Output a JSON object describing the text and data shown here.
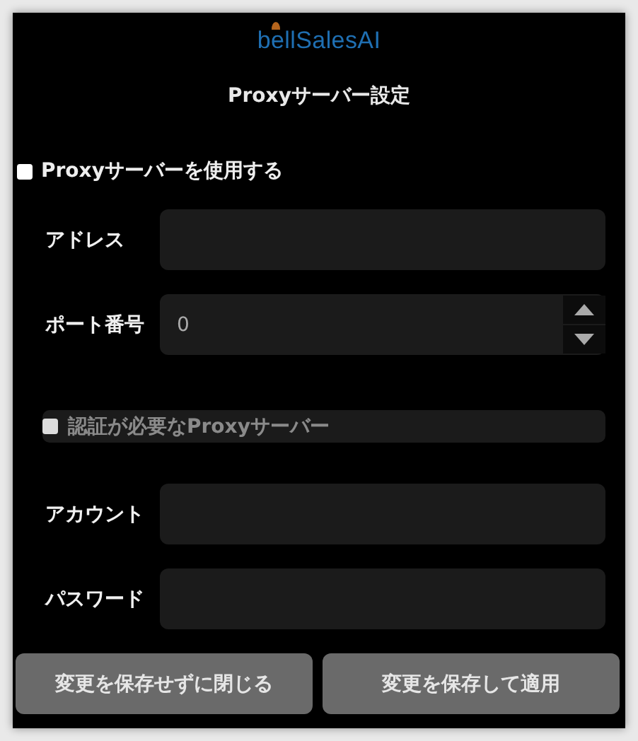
{
  "logo": {
    "text": "bellSalesAI"
  },
  "title": "Proxyサーバー設定",
  "use_proxy": {
    "label": "Proxyサーバーを使用する",
    "checked": false
  },
  "fields": [
    {
      "label": "アドレス",
      "kind": "text"
    },
    {
      "label": "ポート番号",
      "kind": "number",
      "value": "0"
    }
  ],
  "auth": {
    "label": "認証が必要なProxyサーバー",
    "checked": false,
    "disabled": true
  },
  "auth_fields": [
    {
      "label": "アカウント"
    },
    {
      "label": "パスワード"
    }
  ],
  "buttons": [
    "変更を保存せずに閉じる",
    "変更を保存して適用"
  ]
}
